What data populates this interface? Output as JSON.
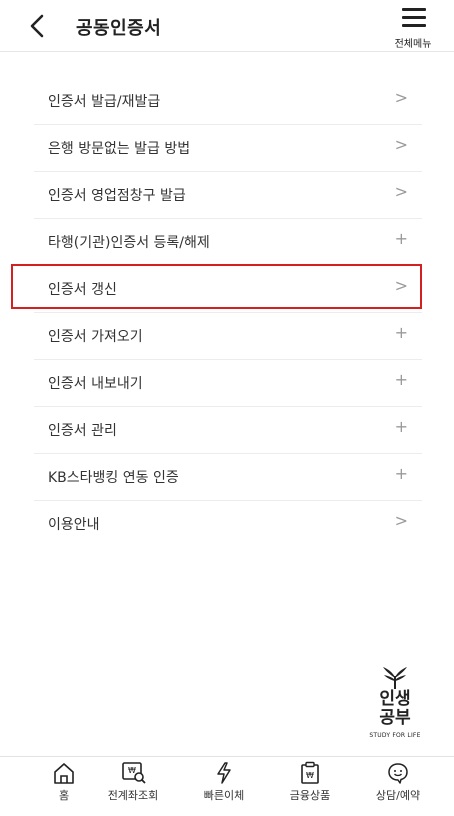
{
  "header": {
    "title": "공동인증서",
    "menu_label": "전체메뉴"
  },
  "menu_items": [
    {
      "label": "인증서 발급/재발급",
      "sign": ">"
    },
    {
      "label": "은행 방문없는 발급 방법",
      "sign": ">"
    },
    {
      "label": "인증서 영업점창구 발급",
      "sign": ">"
    },
    {
      "label": "타행(기관)인증서 등록/해제",
      "sign": "+"
    },
    {
      "label": "인증서 갱신",
      "sign": ">"
    },
    {
      "label": "인증서 가져오기",
      "sign": "+"
    },
    {
      "label": "인증서 내보내기",
      "sign": "+"
    },
    {
      "label": "인증서 관리",
      "sign": "+"
    },
    {
      "label": "KB스타뱅킹 연동 인증",
      "sign": "+"
    },
    {
      "label": "이용안내",
      "sign": ">"
    }
  ],
  "logo": {
    "line1": "인생",
    "line2": "공부",
    "sub": "STUDY FOR LIFE"
  },
  "tabbar": [
    {
      "label": "홈",
      "icon": "home-icon"
    },
    {
      "label": "전계좌조회",
      "icon": "account-search-icon"
    },
    {
      "label": "빠른이체",
      "icon": "lightning-icon"
    },
    {
      "label": "금융상품",
      "icon": "product-icon"
    },
    {
      "label": "상담/예약",
      "icon": "chat-icon"
    }
  ],
  "colors": {
    "highlight": "#d32020",
    "text": "#333333",
    "divider": "#ececec"
  }
}
